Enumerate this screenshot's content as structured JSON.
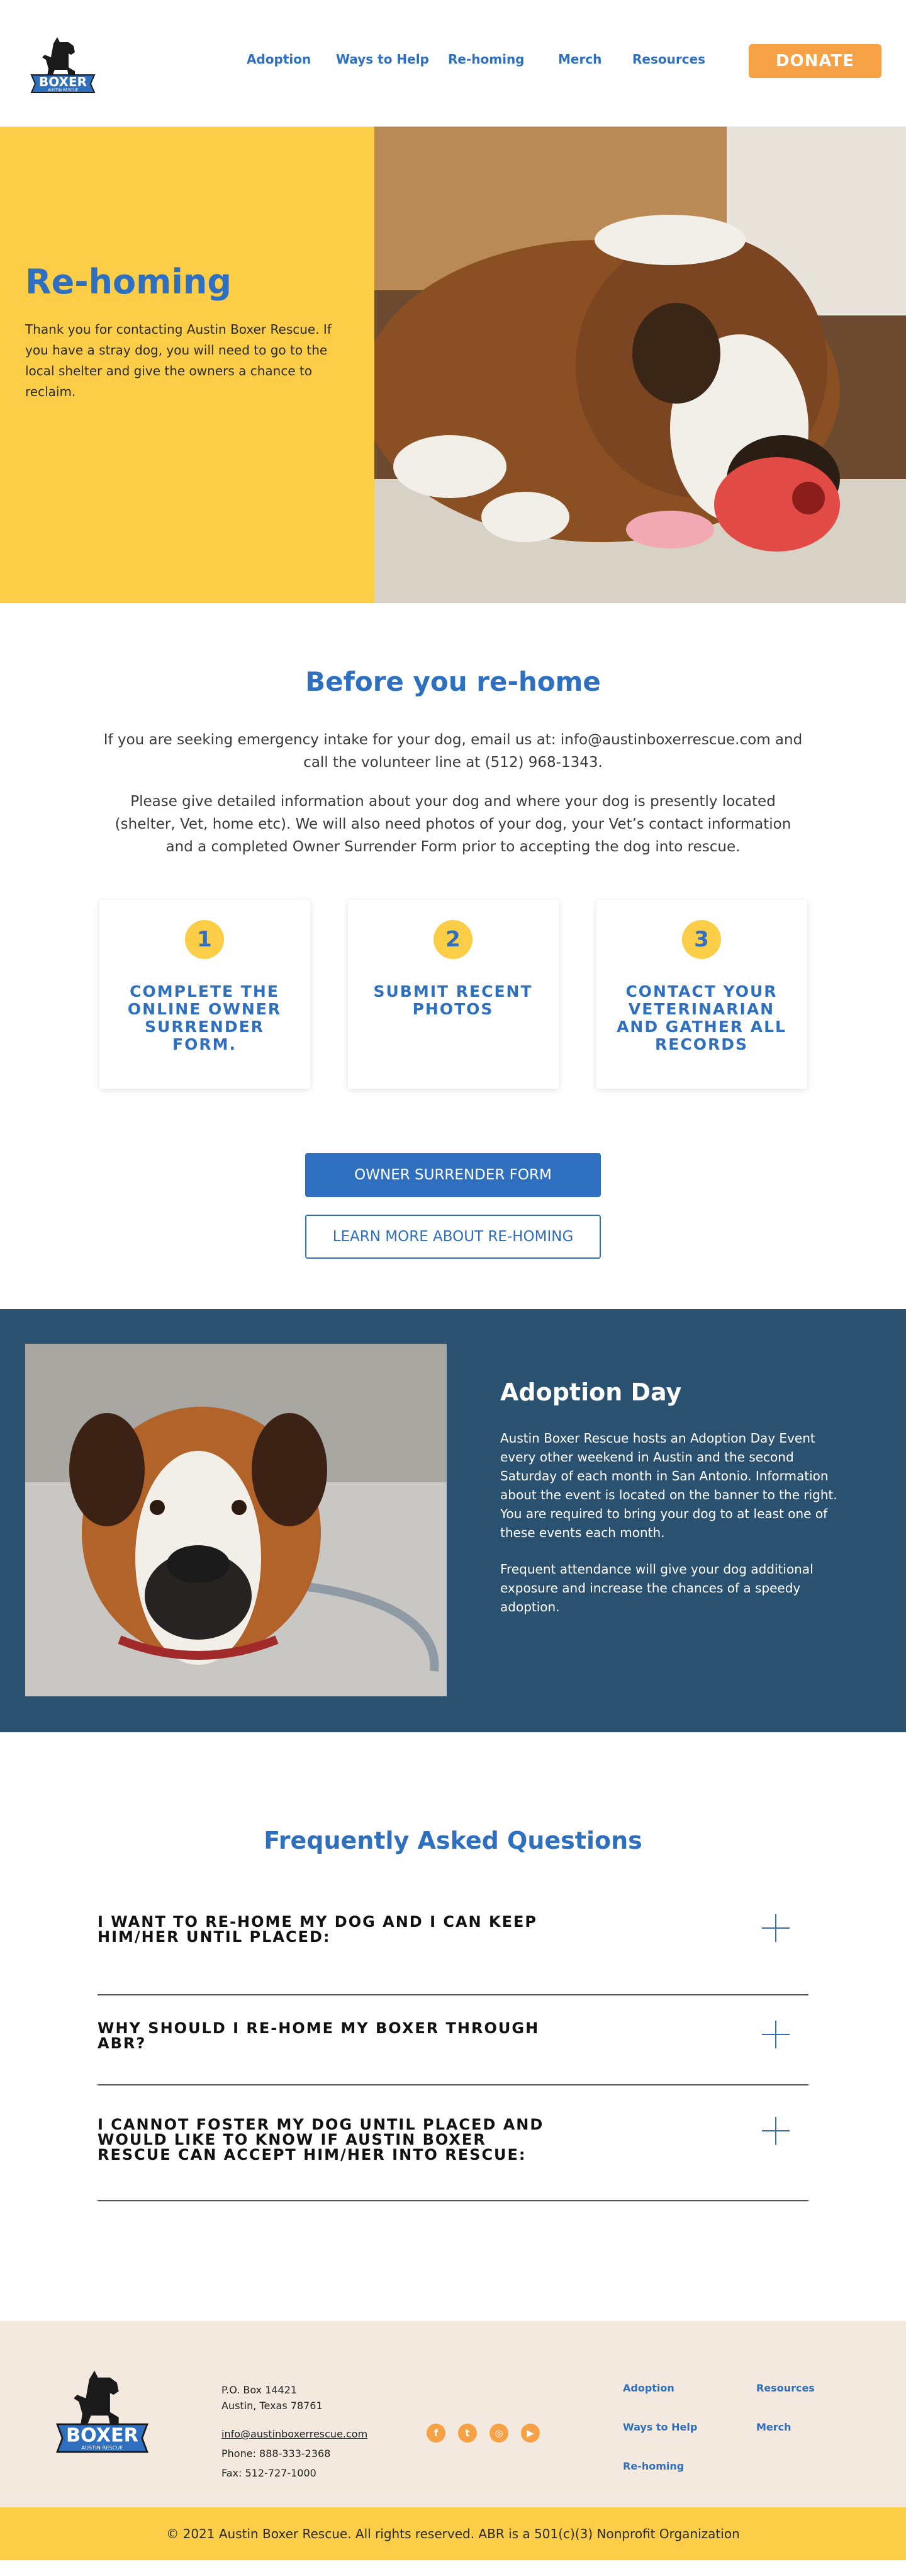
{
  "brand": {
    "logo_word": "BOXER",
    "logo_sub": "AUSTIN RESCUE",
    "accent": "#2f6fbf",
    "yellow": "#fccd47",
    "orange": "#f7a146",
    "navy": "#2b5171"
  },
  "nav": {
    "items": [
      "Adoption",
      "Ways to Help",
      "Re-homing",
      "Merch",
      "Resources"
    ],
    "donate": "DONATE"
  },
  "hero": {
    "title": "Re-homing",
    "text": "Thank you for contacting Austin Boxer Rescue. If you have a stray dog, you will need to go to the local shelter and give the owners a chance to reclaim."
  },
  "before": {
    "title": "Before you re-home",
    "p1": "If you are seeking emergency intake for your dog, email us at: info@austinboxerrescue.com and call the volunteer line at (512) 968-1343.",
    "p2": "Please give detailed information about your dog and where your dog is presently located (shelter, Vet, home etc). We will also need photos of your dog, your Vet’s contact information and a completed Owner Surrender Form prior to accepting the dog into rescue.",
    "steps": [
      {
        "num": "1",
        "text": "COMPLETE THE ONLINE OWNER SURRENDER FORM."
      },
      {
        "num": "2",
        "text": "SUBMIT RECENT PHOTOS"
      },
      {
        "num": "3",
        "text": "CONTACT YOUR VETERINARIAN AND GATHER ALL RECORDS"
      }
    ],
    "btn_primary": "OWNER SURRENDER FORM",
    "btn_secondary": "LEARN MORE ABOUT RE-HOMING"
  },
  "adoption_day": {
    "title": "Adoption Day",
    "p1": "Austin Boxer Rescue hosts an Adoption Day Event every other weekend in Austin and the second Saturday of each month in San Antonio. Information about the event is located on the banner to the right. You are required to bring your dog to at least one of these events each month.",
    "p2": "Frequent attendance will give your dog additional exposure and increase the chances of a speedy adoption."
  },
  "faq": {
    "title": "Frequently Asked Questions",
    "items": [
      "I WANT TO RE-HOME MY DOG AND I CAN KEEP HIM/HER UNTIL PLACED:",
      "WHY SHOULD I RE-HOME MY BOXER THROUGH ABR?",
      "I CANNOT FOSTER MY DOG UNTIL PLACED AND WOULD LIKE TO KNOW IF AUSTIN BOXER RESCUE CAN ACCEPT HIM/HER INTO RESCUE:"
    ]
  },
  "footer": {
    "po_box": "P.O. Box 14421",
    "city": "Austin, Texas 78761",
    "email": "info@austinboxerrescue.com",
    "phone": "Phone: 888-333-2368",
    "fax": "Fax: 512-727-1000",
    "social": [
      "facebook-icon",
      "twitter-icon",
      "instagram-icon",
      "youtube-icon"
    ],
    "links": {
      "adoption": "Adoption",
      "resources": "Resources",
      "ways": "Ways to Help",
      "merch": "Merch",
      "rehoming": "Re-homing"
    },
    "copyright": "© 2021 Austin Boxer Rescue. All rights reserved. ABR is a 501(c)(3) Nonprofit Organization"
  }
}
